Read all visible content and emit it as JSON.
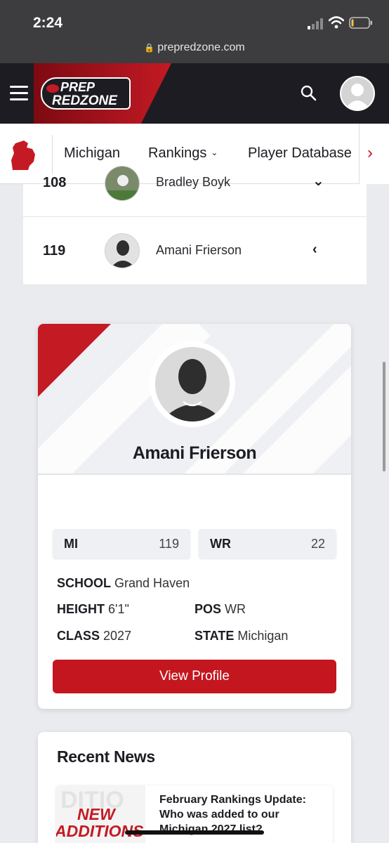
{
  "status_bar": {
    "time": "2:24"
  },
  "browser": {
    "url": "prepredzone.com"
  },
  "header": {
    "logo_line1": "PREP",
    "logo_line2": "REDZONE"
  },
  "state_nav": {
    "items": [
      {
        "label": "Michigan"
      },
      {
        "label": "Rankings",
        "has_dropdown": true
      },
      {
        "label": "Player Database"
      }
    ],
    "next_arrow": "›"
  },
  "ranking_rows": [
    {
      "rank": "108",
      "name": "Bradley Boyk",
      "caret": "⌄"
    },
    {
      "rank": "119",
      "name": "Amani Frierson",
      "caret": "‹"
    }
  ],
  "player_card": {
    "name": "Amani Frierson",
    "stats": [
      {
        "label": "MI",
        "value": "119"
      },
      {
        "label": "WR",
        "value": "22"
      }
    ],
    "info": {
      "school_label": "SCHOOL",
      "school_value": "Grand Haven",
      "height_label": "HEIGHT",
      "height_value": "6'1\"",
      "pos_label": "POS",
      "pos_value": "WR",
      "class_label": "CLASS",
      "class_value": "2027",
      "state_label": "STATE",
      "state_value": "Michigan"
    },
    "button_label": "View Profile"
  },
  "recent_news": {
    "heading": "Recent News",
    "items": [
      {
        "thumb_line1": "NEW",
        "thumb_line2": "ADDITIONS",
        "title": "February Rankings Update: Who was added to our Michigan 2027 list?"
      }
    ]
  },
  "colors": {
    "brand_red": "#c4161f",
    "header_dark": "#1d1c22"
  }
}
